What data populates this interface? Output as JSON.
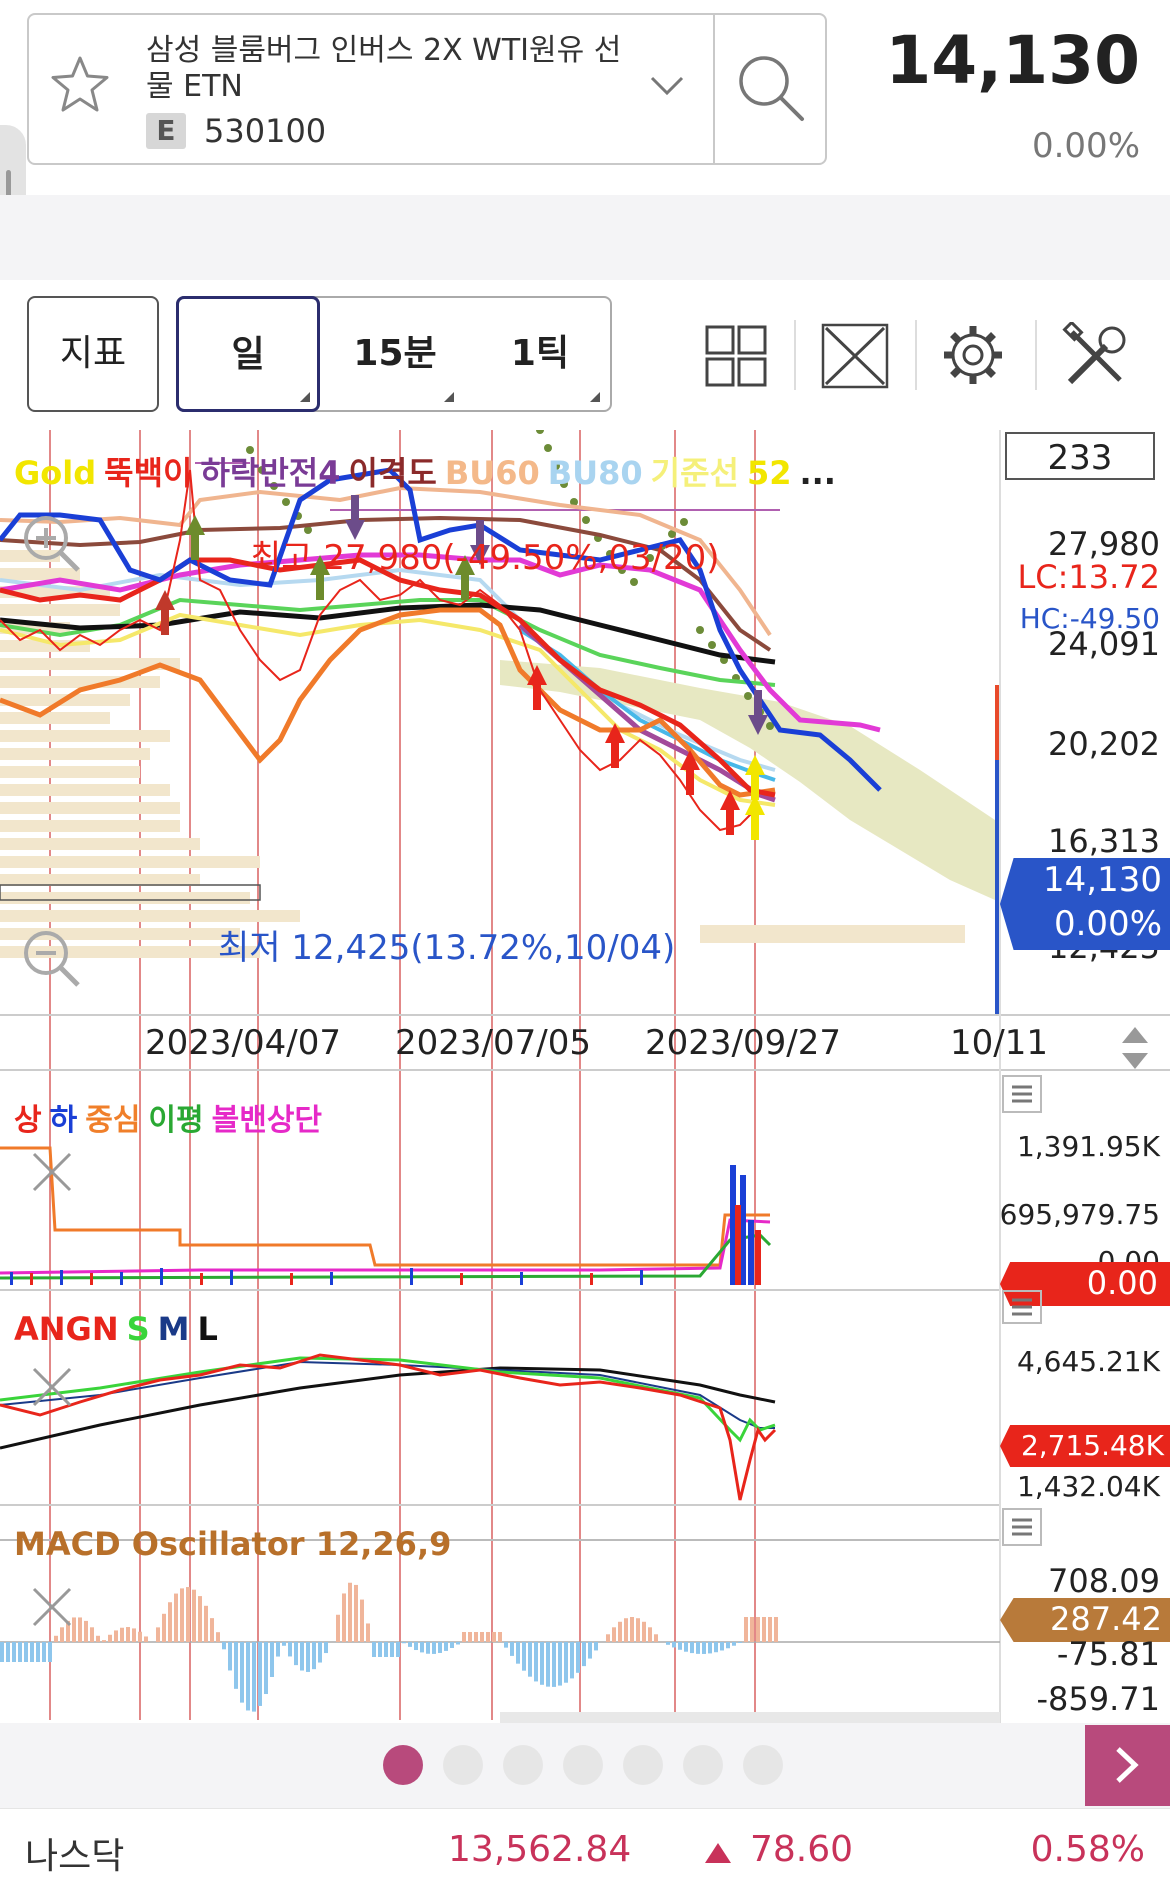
{
  "stock": {
    "name": "삼성 블룸버그 인버스 2X WTI원유 선물 ETN",
    "badge": "E",
    "code": "530100",
    "price": "14,130",
    "change_pct": "0.00%"
  },
  "toolbar": {
    "indicator_button": "지표",
    "period_day": "일",
    "period_15min": "15분",
    "period_tick": "1틱"
  },
  "main_chart": {
    "count_box": "233",
    "legend": [
      {
        "text": "Gold",
        "color": "#f2e600"
      },
      {
        "text": "뚝백이",
        "color": "#e8251b"
      },
      {
        "text": "하락반전4",
        "color": "#7a3b96"
      },
      {
        "text": "이격도",
        "color": "#8b2a2a"
      },
      {
        "text": "BU60",
        "color": "#f4b98a"
      },
      {
        "text": "BU80",
        "color": "#a9d4f0"
      },
      {
        "text": "기준선",
        "color": "#f5f07a"
      },
      {
        "text": "52",
        "color": "#f2e600"
      },
      {
        "text": "...",
        "color": "#222222"
      }
    ],
    "high_label": "최고 27,980(-49.50%,03/20)",
    "low_label": "최저 12,425(13.72%,10/04)",
    "y_ticks": [
      "27,980",
      "24,091",
      "20,202",
      "16,313",
      "12,425"
    ],
    "lc_label": "LC:13.72",
    "hc_label": "HC:-49.50",
    "current_price_box": "14,130",
    "current_pct_box": "0.00%",
    "x_ticks": [
      "2023/04/07",
      "2023/07/05",
      "2023/09/27",
      "10/11"
    ]
  },
  "volume_panel": {
    "legend": [
      {
        "text": "상",
        "color": "#e8251b"
      },
      {
        "text": "하",
        "color": "#1a3fd6"
      },
      {
        "text": "중심",
        "color": "#f07f2a"
      },
      {
        "text": "이평",
        "color": "#2aa833"
      },
      {
        "text": "볼밴상단",
        "color": "#e629c8"
      }
    ],
    "y_ticks": [
      "1,391.95K",
      "695,979.75",
      "0.00"
    ],
    "current_box": "0.00"
  },
  "angn_panel": {
    "legend": [
      {
        "text": "ANGN",
        "color": "#e8251b"
      },
      {
        "text": "S",
        "color": "#3ad43a"
      },
      {
        "text": "M",
        "color": "#1a3a88"
      },
      {
        "text": "L",
        "color": "#111111"
      }
    ],
    "y_ticks": [
      "4,645.21K",
      "2,715.48K",
      "1,432.04K"
    ],
    "current_box": "2,715.48K"
  },
  "macd_panel": {
    "legend": "MACD Oscillator 12,26,9",
    "y_ticks": [
      "708.09",
      "-75.81",
      "-859.71"
    ],
    "current_box": "287.42"
  },
  "pager": {
    "pages": 7,
    "active": 0
  },
  "footer": {
    "index_name": "나스닥",
    "value": "13,562.84",
    "change": "78.60",
    "change_pct": "0.58%"
  },
  "colors": {
    "up": "#c8325a",
    "down_blue": "#2955c8",
    "accent_pink": "#b84a7c",
    "gold": "#f2e600"
  }
}
